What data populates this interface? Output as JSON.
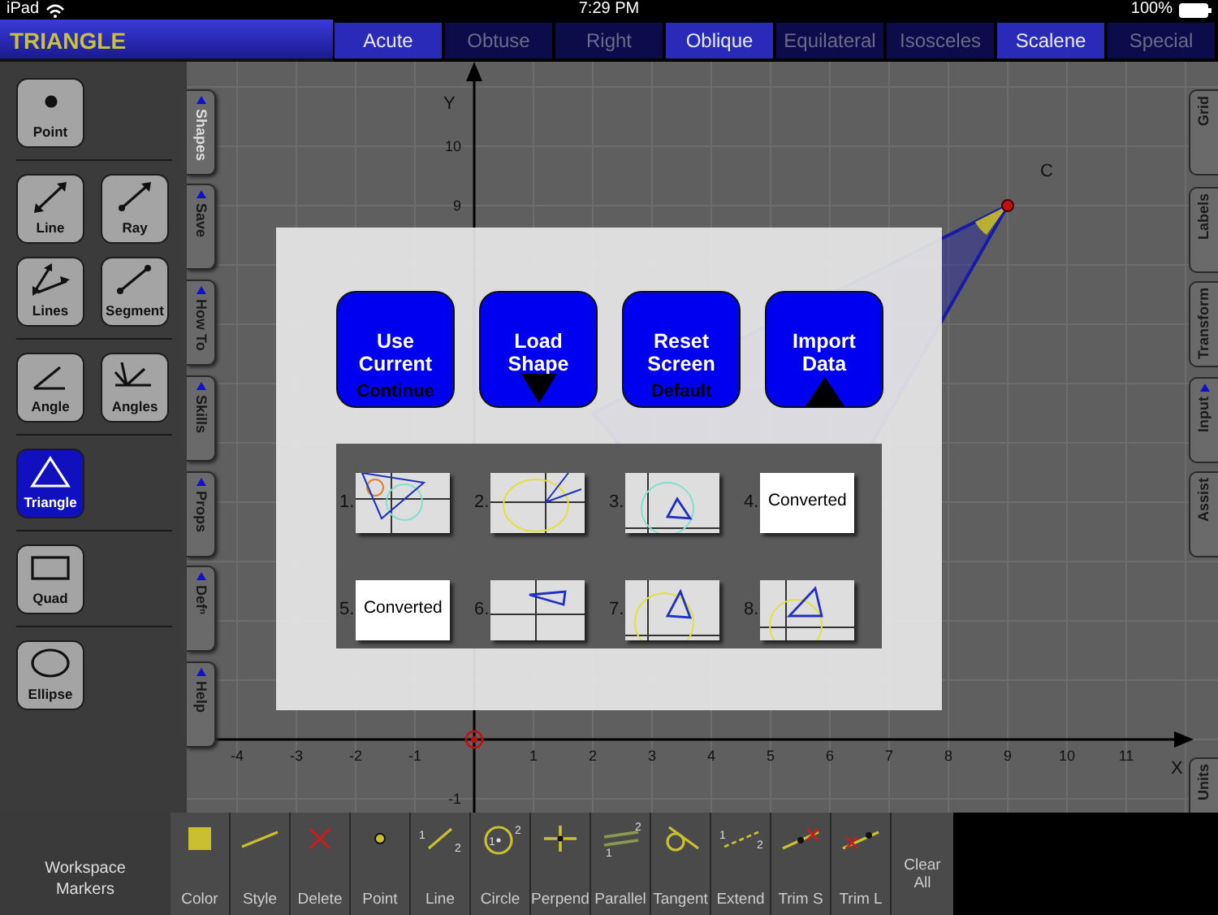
{
  "status_bar": {
    "device": "iPad",
    "time": "7:29 PM",
    "battery": "100%"
  },
  "title": "TRIANGLE",
  "tabs": [
    {
      "label": "Acute",
      "selected": true
    },
    {
      "label": "Obtuse",
      "selected": false
    },
    {
      "label": "Right",
      "selected": false
    },
    {
      "label": "Oblique",
      "selected": true
    },
    {
      "label": "Equilateral",
      "selected": false
    },
    {
      "label": "Isosceles",
      "selected": false
    },
    {
      "label": "Scalene",
      "selected": true
    },
    {
      "label": "Special",
      "selected": false
    }
  ],
  "tool_groups": [
    {
      "tools": [
        {
          "label": "Point",
          "kind": "point",
          "selected": false
        }
      ]
    },
    {
      "tools": [
        {
          "label": "Line",
          "kind": "line",
          "selected": false
        },
        {
          "label": "Ray",
          "kind": "ray",
          "selected": false
        },
        {
          "label": "Lines",
          "kind": "lines",
          "selected": false
        },
        {
          "label": "Segment",
          "kind": "segment",
          "selected": false
        }
      ]
    },
    {
      "tools": [
        {
          "label": "Angle",
          "kind": "angle",
          "selected": false
        },
        {
          "label": "Angles",
          "kind": "angles",
          "selected": false
        }
      ]
    },
    {
      "tools": [
        {
          "label": "Triangle",
          "kind": "triangle",
          "selected": true
        }
      ]
    },
    {
      "tools": [
        {
          "label": "Quad",
          "kind": "quad",
          "selected": false
        }
      ]
    },
    {
      "tools": [
        {
          "label": "Ellipse",
          "kind": "ellipse",
          "selected": false
        }
      ]
    }
  ],
  "left_tabs": [
    {
      "label": "Shapes",
      "selected": true,
      "flag": true
    },
    {
      "label": "Save",
      "selected": false,
      "flag": true
    },
    {
      "label": "How To",
      "selected": false,
      "flag": true
    },
    {
      "label": "Skills",
      "selected": false,
      "flag": true
    },
    {
      "label": "Props",
      "selected": false,
      "flag": true
    },
    {
      "label": "Defⁿ",
      "selected": false,
      "flag": true
    },
    {
      "label": "Help",
      "selected": false,
      "flag": true
    }
  ],
  "right_tabs": [
    {
      "label": "Grid",
      "flag": false
    },
    {
      "label": "Labels",
      "flag": false
    },
    {
      "label": "Transform",
      "flag": false
    },
    {
      "label": "Input",
      "flag": true
    },
    {
      "label": "Assist",
      "flag": false
    }
  ],
  "right_bottom_tabs": [
    {
      "label": "Units",
      "flag": false
    }
  ],
  "graph": {
    "axis_x": "X",
    "axis_y": "Y",
    "x_ticks": [
      "-4",
      "-3",
      "-2",
      "-1",
      "1",
      "2",
      "3",
      "4",
      "5",
      "6",
      "7",
      "8",
      "9",
      "10",
      "11"
    ],
    "y_ticks": [
      "10",
      "9",
      "-1"
    ],
    "points": [
      {
        "label": "C"
      }
    ]
  },
  "dialog": {
    "buttons": [
      {
        "label": "Use Current",
        "kind": "text",
        "caption": "Continue"
      },
      {
        "label": "Load Shape",
        "kind": "down"
      },
      {
        "label": "Reset Screen",
        "kind": "text",
        "caption": "Default"
      },
      {
        "label": "Import Data",
        "kind": "up"
      }
    ],
    "slots": [
      {
        "number": "1.",
        "kind": "preview"
      },
      {
        "number": "2.",
        "kind": "preview"
      },
      {
        "number": "3.",
        "kind": "preview"
      },
      {
        "number": "4.",
        "kind": "text",
        "text": "Converted"
      },
      {
        "number": "5.",
        "kind": "text",
        "text": "Converted"
      },
      {
        "number": "6.",
        "kind": "preview"
      },
      {
        "number": "7.",
        "kind": "preview"
      },
      {
        "number": "8.",
        "kind": "preview"
      }
    ]
  },
  "bottom_bar": {
    "label": "Workspace Markers",
    "tools": [
      {
        "label": "Color",
        "kind": "color"
      },
      {
        "label": "Style",
        "kind": "style"
      },
      {
        "label": "Delete",
        "kind": "delete"
      },
      {
        "label": "Point",
        "kind": "point"
      },
      {
        "label": "Line",
        "kind": "line",
        "marks": [
          "1",
          "2"
        ]
      },
      {
        "label": "Circle",
        "kind": "circle",
        "marks": [
          "1",
          "2"
        ]
      },
      {
        "label": "Perpend",
        "kind": "perpend"
      },
      {
        "label": "Parallel",
        "kind": "parallel",
        "marks": [
          "1",
          "2"
        ]
      },
      {
        "label": "Tangent",
        "kind": "tangent"
      },
      {
        "label": "Extend",
        "kind": "extend",
        "marks": [
          "1",
          "2"
        ]
      },
      {
        "label": "Trim S",
        "kind": "trims"
      },
      {
        "label": "Trim L",
        "kind": "triml"
      }
    ],
    "clear": "Clear All"
  }
}
